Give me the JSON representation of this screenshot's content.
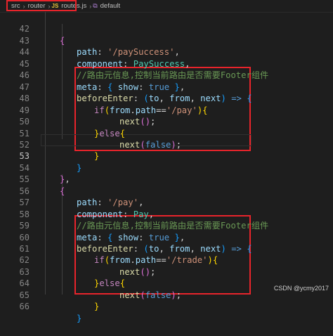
{
  "breadcrumb": {
    "items": [
      "src",
      "router",
      "routes.js",
      "default"
    ],
    "file_badge": "JS"
  },
  "editor": {
    "line_numbers": [
      "42",
      "43",
      "44",
      "45",
      "46",
      "47",
      "48",
      "49",
      "50",
      "51",
      "52",
      "53",
      "54",
      "55",
      "56",
      "57",
      "58",
      "59",
      "60",
      "61",
      "62",
      "63",
      "64",
      "65",
      "66"
    ],
    "active_line": "53",
    "text": {
      "l42_brace": "{",
      "l43_path_key": "path",
      "l43_path_val": "'/paySuccess'",
      "l44_component_key": "component",
      "l44_component_val": "PaySuccess",
      "l45_comment": "//路由元信息,控制当前路由是否需要Footer组件",
      "meta_key": "meta",
      "show_key": "show",
      "true_kw": "true",
      "before_enter": "beforeEnter",
      "to": "to",
      "from": "from",
      "next": "next",
      "arrow": "=>",
      "if_kw": "if",
      "path_prop": "path",
      "l48_str": "'/pay'",
      "l61_str": "'/trade'",
      "else_kw": "else",
      "false_kw": "false",
      "l57_path_val": "'/pay'",
      "l58_component_val": "Pay"
    }
  },
  "watermark": "CSDN @ycmy2017",
  "colors": {
    "background": "#1e1e1e",
    "highlight_box": "#e8242b"
  },
  "icons": [
    "javascript-file-icon",
    "symbol-icon",
    "chevron-right-icon"
  ]
}
